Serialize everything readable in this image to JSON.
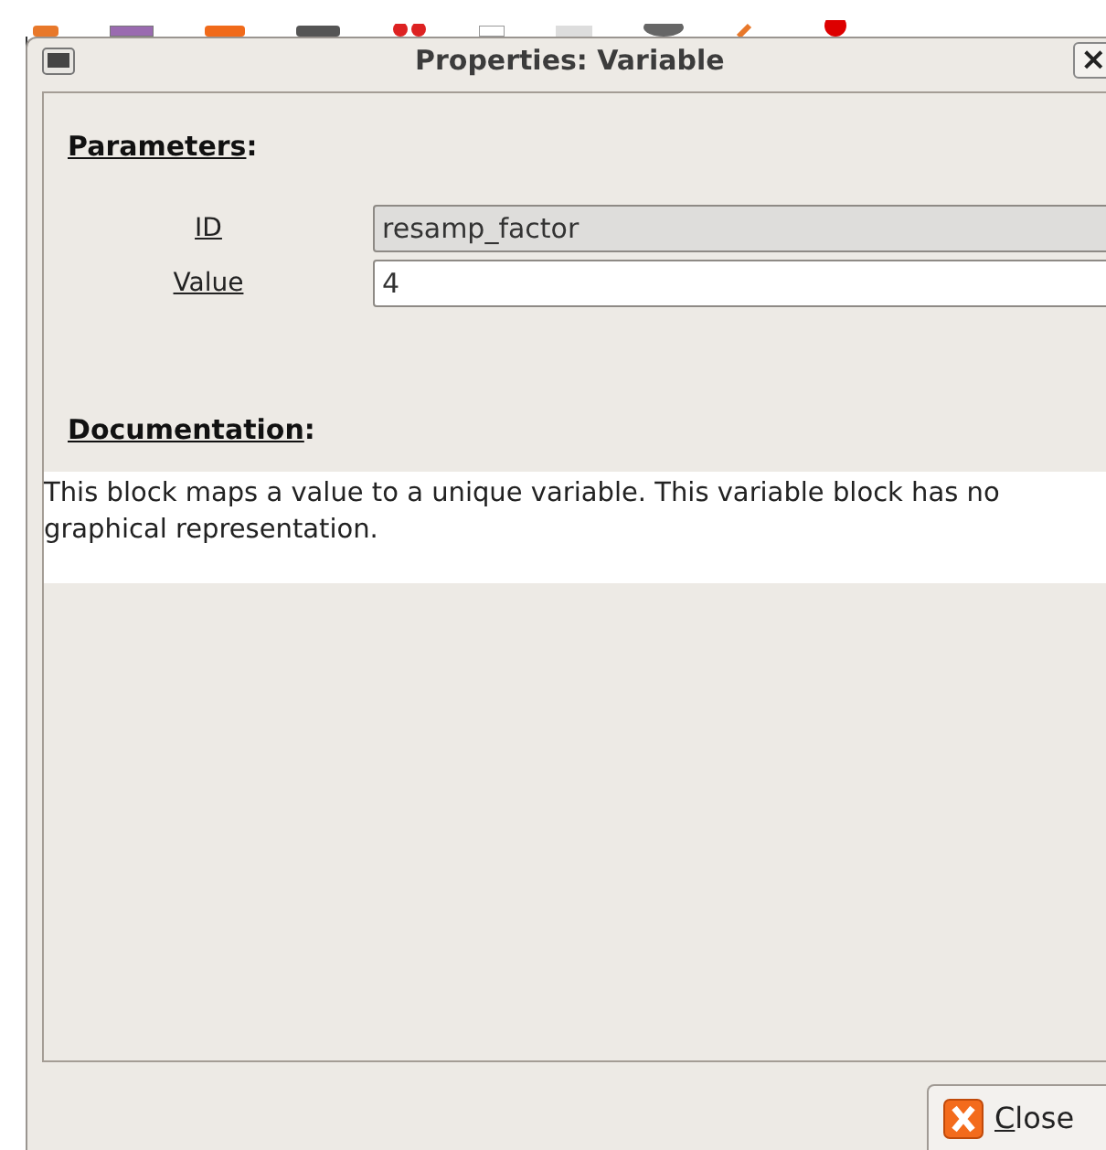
{
  "window": {
    "title": "Properties: Variable",
    "close_glyph": "×"
  },
  "parameters": {
    "heading": "Parameters",
    "suffix": ":",
    "fields": [
      {
        "label": "ID",
        "value": "resamp_factor",
        "disabled": true
      },
      {
        "label": "Value",
        "value": "4",
        "disabled": false
      }
    ]
  },
  "documentation": {
    "heading": "Documentation",
    "suffix": ":",
    "text": "This block maps a value to a unique variable. This variable block has no graphical representation."
  },
  "buttons": [
    {
      "label": "Close"
    }
  ]
}
